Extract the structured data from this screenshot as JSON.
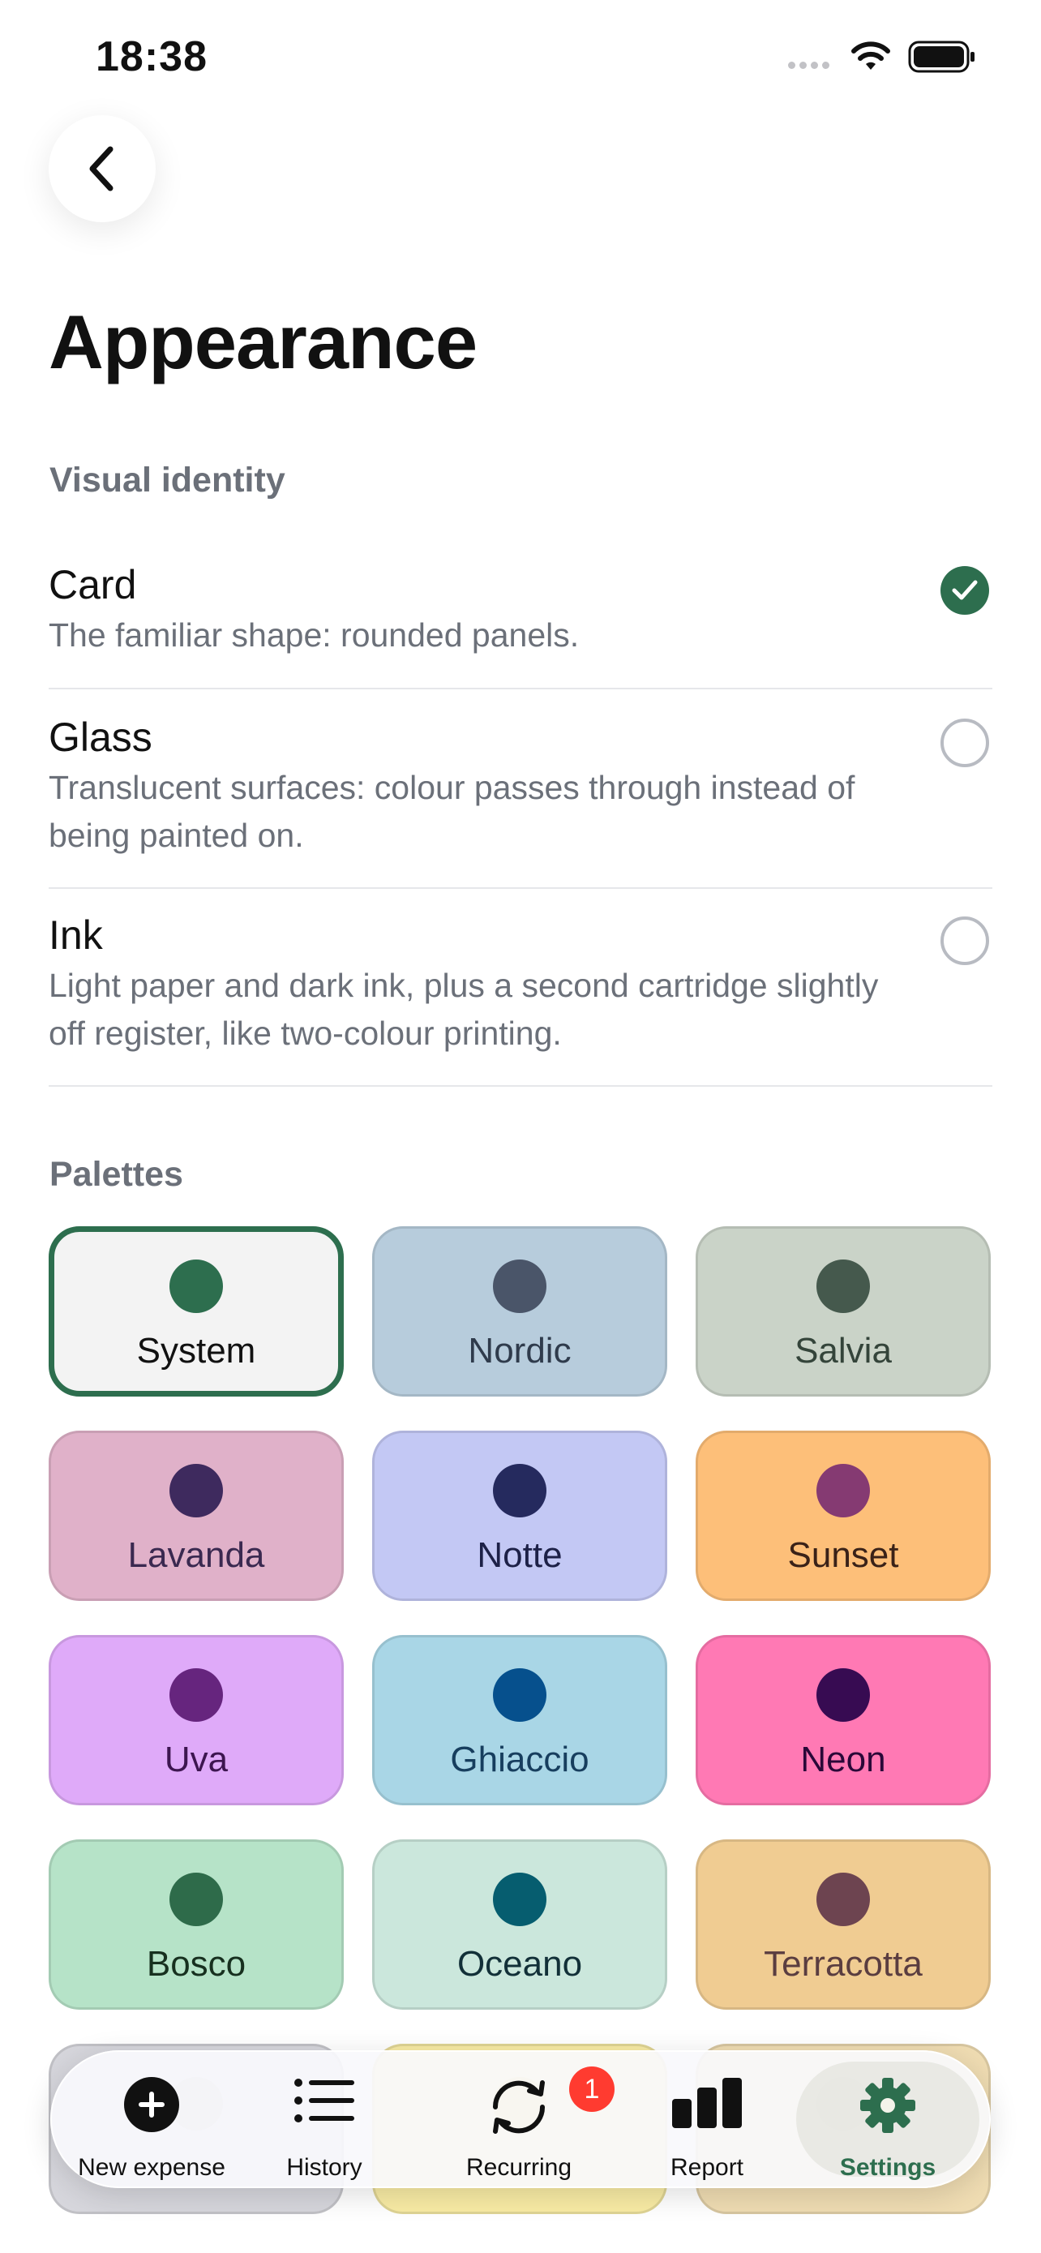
{
  "status_bar": {
    "time": "18:38"
  },
  "header": {
    "back_icon": "chevron-left-icon",
    "title": "Appearance"
  },
  "visual_identity": {
    "label": "Visual identity",
    "options": [
      {
        "title": "Card",
        "description": "The familiar shape: rounded panels.",
        "selected": true
      },
      {
        "title": "Glass",
        "description": "Translucent surfaces: colour passes through instead of being painted on.",
        "selected": false
      },
      {
        "title": "Ink",
        "description": "Light paper and dark ink, plus a second cartridge slightly off register, like two-colour printing.",
        "selected": false
      }
    ]
  },
  "palettes": {
    "label": "Palettes",
    "items": [
      {
        "name": "System",
        "bg": "#f3f3f3",
        "dot": "#2d6e4e",
        "text": "#111111",
        "selected": true
      },
      {
        "name": "Nordic",
        "bg": "#b7ccdc",
        "dot": "#4a5569",
        "text": "#2f3b4c",
        "selected": false
      },
      {
        "name": "Salvia",
        "bg": "#cad3c8",
        "dot": "#45594d",
        "text": "#34443a",
        "selected": false
      },
      {
        "name": "Lavanda",
        "bg": "#e0b1c9",
        "dot": "#3e2a5e",
        "text": "#3a2950",
        "selected": false
      },
      {
        "name": "Notte",
        "bg": "#c3c8f4",
        "dot": "#252a5e",
        "text": "#1d2147",
        "selected": false
      },
      {
        "name": "Sunset",
        "bg": "#fdbf79",
        "dot": "#853a72",
        "text": "#3a2218",
        "selected": false
      },
      {
        "name": "Uva",
        "bg": "#dfaaf9",
        "dot": "#66257e",
        "text": "#3d1650",
        "selected": false
      },
      {
        "name": "Ghiaccio",
        "bg": "#a9d6e6",
        "dot": "#06508d",
        "text": "#173e5e",
        "selected": false
      },
      {
        "name": "Neon",
        "bg": "#ff79b4",
        "dot": "#370b52",
        "text": "#2a0838",
        "selected": false
      },
      {
        "name": "Bosco",
        "bg": "#b6e3c8",
        "dot": "#2e6b4a",
        "text": "#17301f",
        "selected": false
      },
      {
        "name": "Oceano",
        "bg": "#cbe7dc",
        "dot": "#065d6f",
        "text": "#123038",
        "selected": false
      },
      {
        "name": "Terracotta",
        "bg": "#f0cc92",
        "dot": "#6d4450",
        "text": "#5a3d40",
        "selected": false
      },
      {
        "name": "",
        "bg": "#d6d6dc",
        "dot": "#b8b8c2",
        "text": "#999999",
        "selected": false
      },
      {
        "name": "",
        "bg": "#f8eba4",
        "dot": "#e9d468",
        "text": "#999999",
        "selected": false
      },
      {
        "name": "",
        "bg": "#efdcb2",
        "dot": "#d9c08c",
        "text": "#999999",
        "selected": false
      }
    ]
  },
  "tab_bar": {
    "tabs": [
      {
        "label": "New expense",
        "icon": "plus-circle-icon"
      },
      {
        "label": "History",
        "icon": "list-icon"
      },
      {
        "label": "Recurring",
        "icon": "repeat-icon",
        "badge": "1"
      },
      {
        "label": "Report",
        "icon": "bar-chart-icon"
      },
      {
        "label": "Settings",
        "icon": "gear-icon",
        "active": true
      }
    ]
  }
}
